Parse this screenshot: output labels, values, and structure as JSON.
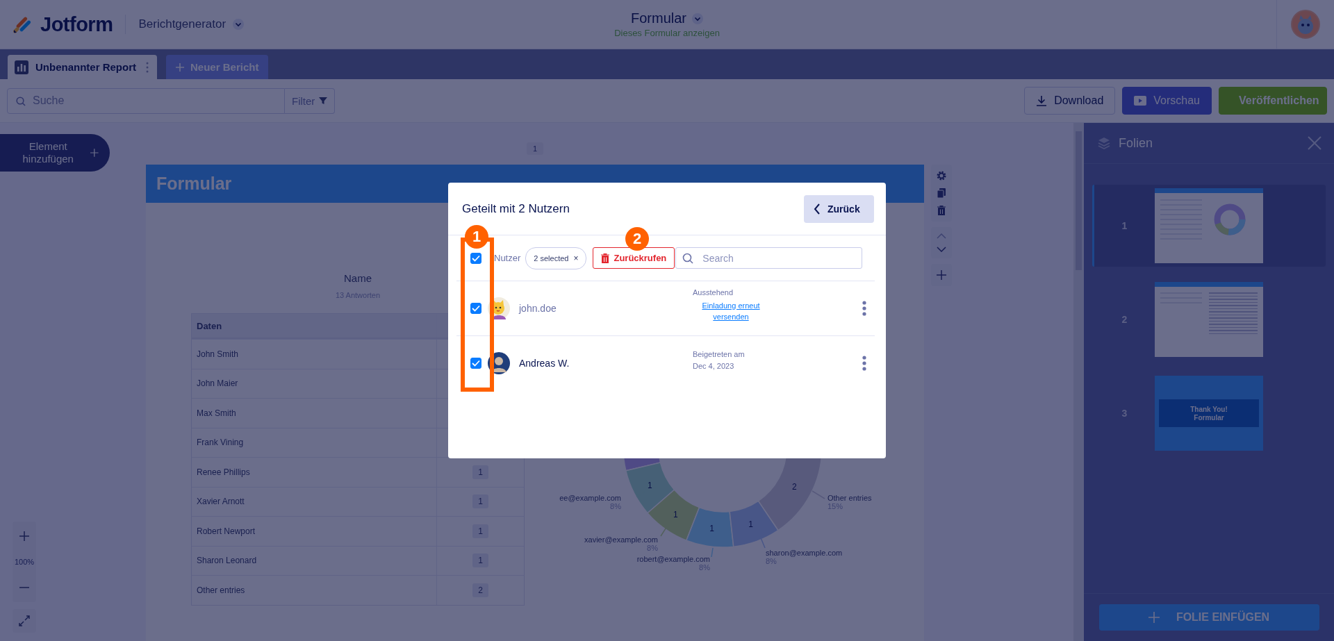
{
  "header": {
    "logo": "Jotform",
    "app_menu": "Berichtgenerator",
    "form_title": "Formular",
    "form_link": "Dieses Formular anzeigen"
  },
  "tabs": [
    {
      "label": "Unbenannter Report",
      "selected": true
    }
  ],
  "new_tab_button": "Neuer Bericht",
  "toolbar": {
    "search_placeholder": "Suche",
    "filter": "Filter",
    "buttons": [
      {
        "kind": "download",
        "label": "Download"
      },
      {
        "kind": "preview",
        "label": "Vorschau"
      },
      {
        "kind": "publish",
        "label": "Veröffentlichen"
      }
    ]
  },
  "add_element": "Element hinzufügen",
  "zoom": {
    "value": "100%"
  },
  "canvas": {
    "page_number": "1",
    "slide_title": "Formular",
    "table_title": "Name",
    "table_subtitle": "13 Antworten",
    "columns": [
      "Daten"
    ],
    "rows": [
      {
        "name": "John Smith"
      },
      {
        "name": "John Maier"
      },
      {
        "name": "Max Smith"
      },
      {
        "name": "Frank Vining"
      },
      {
        "name": "Renee Phillips",
        "count": "1"
      },
      {
        "name": "Xavier Arnott",
        "count": "1"
      },
      {
        "name": "Robert Newport",
        "count": "1"
      },
      {
        "name": "Sharon Leonard",
        "count": "1"
      },
      {
        "name": "Other entries",
        "count": "2"
      }
    ],
    "chart_callouts": [
      {
        "label": "ee@example.com",
        "percent": "8%",
        "value": "1"
      },
      {
        "label": "xavier@example.com",
        "percent": "8%",
        "value": "1"
      },
      {
        "label": "robert@example.com",
        "percent": "8%",
        "value": "1"
      },
      {
        "label": "sharon@example.com",
        "percent": "8%",
        "value": "1"
      },
      {
        "label": "Other entries",
        "percent": "15%",
        "value": "2"
      }
    ]
  },
  "modal": {
    "title": "Geteilt mit 2 Nutzern",
    "back_button": "Zurück",
    "select_all": {
      "checked": true
    },
    "column_label": "Nutzer",
    "selection_chip": "2 selected",
    "chip_close": "×",
    "revoke_button": "Zurückrufen",
    "search_placeholder": "Search",
    "users": [
      {
        "kind": "invited",
        "name": "john.doe",
        "checked": true,
        "status": "Ausstehend",
        "link": "Einladung erneut versenden"
      },
      {
        "kind": "joined",
        "name": "Andreas W.",
        "checked": true,
        "status": "Beigetreten am",
        "date": "Dec 4, 2023"
      }
    ],
    "callouts": [
      "1",
      "2"
    ]
  },
  "slides_panel": {
    "title": "Folien",
    "slides": [
      {
        "number": "1",
        "selected": true,
        "kind": "chart"
      },
      {
        "number": "2",
        "selected": false,
        "kind": "table"
      },
      {
        "number": "3",
        "selected": false,
        "kind": "thanks",
        "heading": "Thank You!",
        "caption": "Formular"
      }
    ],
    "add_button": "FOLIE EINFÜGEN"
  }
}
